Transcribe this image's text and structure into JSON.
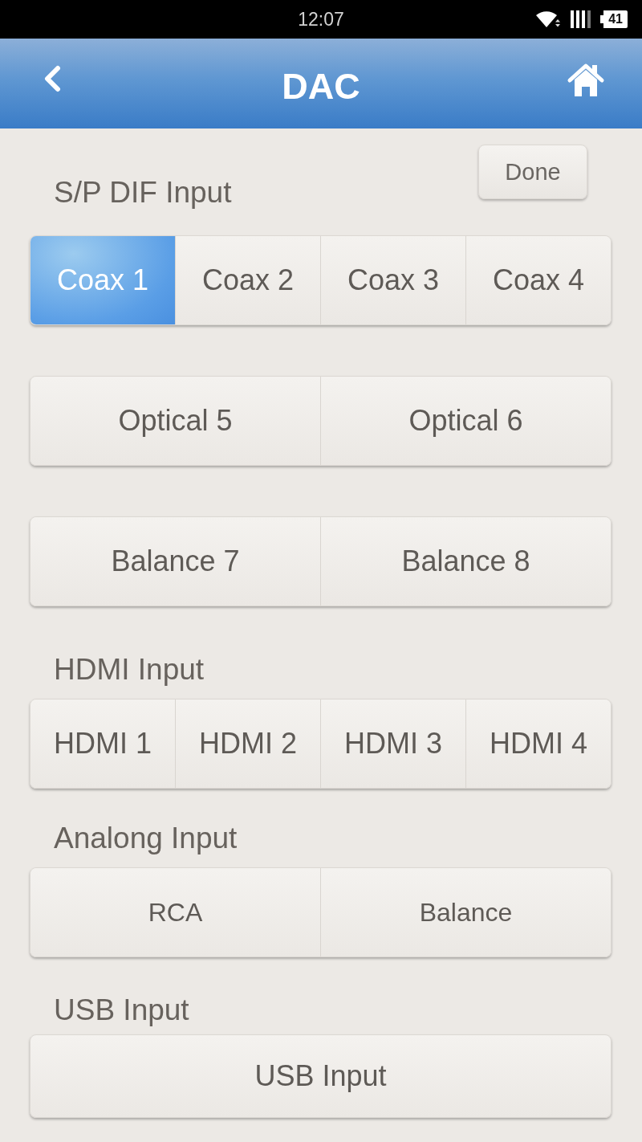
{
  "status_bar": {
    "time": "12:07",
    "battery": "41"
  },
  "header": {
    "title": "DAC"
  },
  "done_button": {
    "label": "Done"
  },
  "sections": [
    {
      "title": "S/P DIF Input",
      "rows": [
        {
          "kind": "regular",
          "buttons": [
            {
              "label": "Coax 1",
              "selected": true
            },
            {
              "label": "Coax 2",
              "selected": false
            },
            {
              "label": "Coax 3",
              "selected": false
            },
            {
              "label": "Coax 4",
              "selected": false
            }
          ]
        },
        {
          "kind": "regular",
          "buttons": [
            {
              "label": "Optical 5",
              "selected": false
            },
            {
              "label": "Optical 6",
              "selected": false
            }
          ]
        },
        {
          "kind": "regular",
          "buttons": [
            {
              "label": "Balance 7",
              "selected": false
            },
            {
              "label": "Balance 8",
              "selected": false
            }
          ]
        }
      ]
    },
    {
      "title": "HDMI Input",
      "rows": [
        {
          "kind": "regular",
          "buttons": [
            {
              "label": "HDMI 1",
              "selected": false
            },
            {
              "label": "HDMI 2",
              "selected": false
            },
            {
              "label": "HDMI 3",
              "selected": false
            },
            {
              "label": "HDMI 4",
              "selected": false
            }
          ]
        }
      ]
    },
    {
      "title": "Analong Input",
      "rows": [
        {
          "kind": "compact",
          "buttons": [
            {
              "label": "RCA",
              "selected": false
            },
            {
              "label": "Balance",
              "selected": false
            }
          ]
        }
      ]
    },
    {
      "title": "USB Input",
      "rows": [
        {
          "kind": "regular",
          "buttons": [
            {
              "label": "USB Input",
              "selected": false
            }
          ]
        }
      ]
    }
  ]
}
